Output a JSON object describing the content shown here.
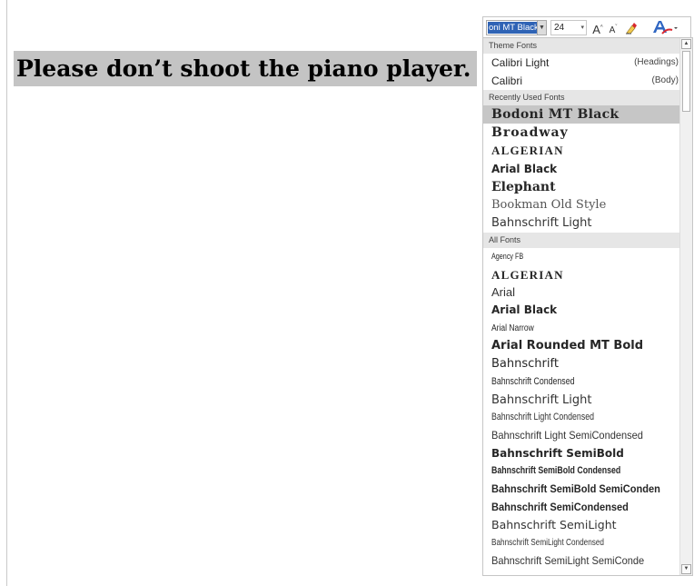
{
  "document": {
    "text": "Please don’t shoot the piano player."
  },
  "mini_toolbar": {
    "font_name": "oni MT Black",
    "font_size": "24",
    "grow_label": "A",
    "shrink_label": "A"
  },
  "font_dropdown": {
    "theme_header": "Theme Fonts",
    "theme_fonts": [
      {
        "name": "Calibri Light",
        "tag": "(Headings)"
      },
      {
        "name": "Calibri",
        "tag": "(Body)"
      }
    ],
    "recent_header": "Recently Used Fonts",
    "recent_fonts": [
      "Bodoni MT Black",
      "Broadway",
      "ALGERIAN",
      "Arial Black",
      "Elephant",
      "Bookman Old Style",
      "Bahnschrift Light"
    ],
    "selected_font": "Bodoni MT Black",
    "all_header": "All Fonts",
    "all_fonts": [
      "Agency FB",
      "ALGERIAN",
      "Arial",
      "Arial Black",
      "Arial Narrow",
      "Arial Rounded MT Bold",
      "Bahnschrift",
      "Bahnschrift Condensed",
      "Bahnschrift Light",
      "Bahnschrift Light Condensed",
      "Bahnschrift Light SemiCondensed",
      "Bahnschrift SemiBold",
      "Bahnschrift SemiBold Condensed",
      "Bahnschrift SemiBold SemiConden",
      "Bahnschrift SemiCondensed",
      "Bahnschrift SemiLight",
      "Bahnschrift SemiLight Condensed",
      "Bahnschrift SemiLight SemiConde"
    ]
  },
  "colors": {
    "selection_blue": "#2f63b5",
    "highlight_gray": "#c4c4c4",
    "font_color_red": "#d9272e",
    "font_icon_blue": "#2f66c2"
  },
  "icons": [
    "grow-font-icon",
    "shrink-font-icon",
    "clear-formatting-icon",
    "font-color-icon",
    "chevron-down-icon",
    "scroll-up-icon",
    "scroll-down-icon"
  ]
}
